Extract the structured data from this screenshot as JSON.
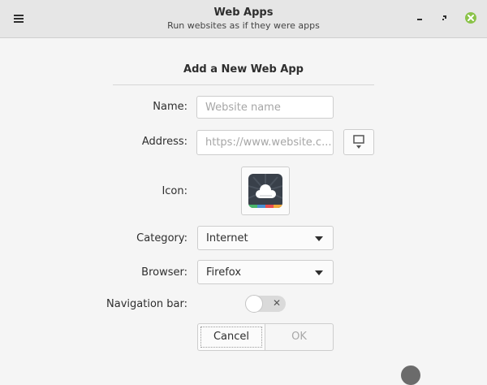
{
  "app": {
    "title": "Web Apps",
    "subtitle": "Run websites as if they were apps"
  },
  "dialog": {
    "heading": "Add a New Web App",
    "name_label": "Name:",
    "name_value": "",
    "name_placeholder": "Website name",
    "address_label": "Address:",
    "address_value": "",
    "address_placeholder": "https://www.website.c...",
    "icon_label": "Icon:",
    "category_label": "Category:",
    "category_value": "Internet",
    "browser_label": "Browser:",
    "browser_value": "Firefox",
    "navbar_label": "Navigation bar:",
    "navbar_on": false,
    "cancel_label": "Cancel",
    "ok_label": "OK"
  },
  "colors": {
    "close_button": "#8bc34a",
    "icon_bg": "#39404a",
    "icon_stripes": [
      "#49b56b",
      "#4a8fd1",
      "#e94f4f",
      "#f0a93a"
    ]
  },
  "icons": {
    "menu": "hamburger-icon",
    "minimize": "minimize-icon",
    "maximize": "maximize-icon",
    "close": "close-icon",
    "favicon_fetch": "download-favicon-icon",
    "app_icon": "cloud-icon"
  }
}
